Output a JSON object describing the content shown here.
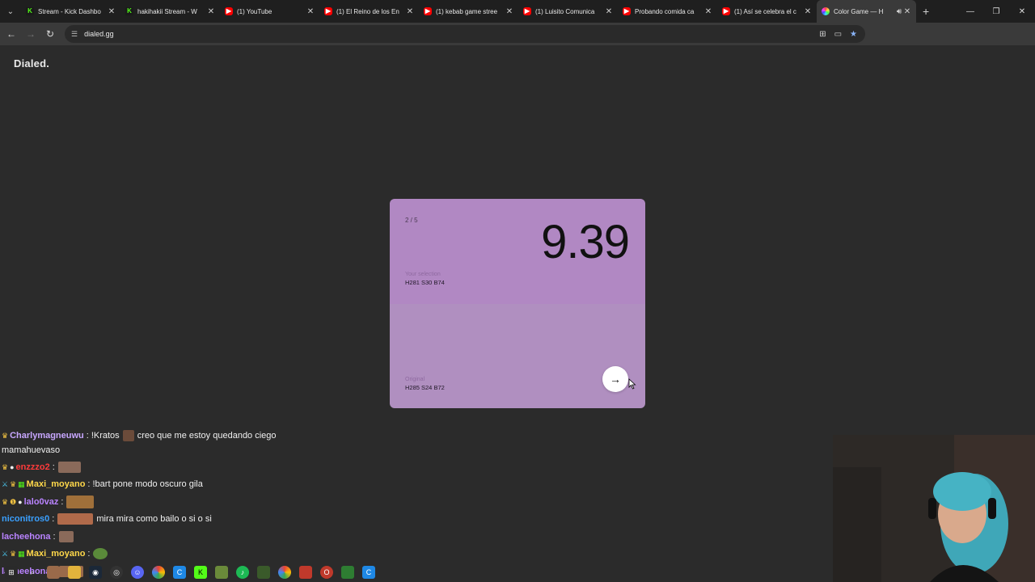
{
  "browser": {
    "tabs": [
      {
        "title": "Stream - Kick Dashbo",
        "favicon": "kick-icon"
      },
      {
        "title": "hakihakii Stream - W",
        "favicon": "kick-icon"
      },
      {
        "title": "(1) YouTube",
        "favicon": "youtube-icon"
      },
      {
        "title": "(1) El Reino de los En",
        "favicon": "youtube-icon"
      },
      {
        "title": "(1) kebab game stree",
        "favicon": "youtube-icon"
      },
      {
        "title": "(1) Luisito Comunica",
        "favicon": "youtube-icon"
      },
      {
        "title": "Probando comida ca",
        "favicon": "youtube-icon"
      },
      {
        "title": "(1) Así se celebra el c",
        "favicon": "youtube-icon"
      },
      {
        "title": "Color Game — H",
        "favicon": "color-game-icon"
      }
    ],
    "active_tab_index": 8,
    "url": "dialed.gg"
  },
  "page": {
    "brand": "Dialed.",
    "game": {
      "round": "2 / 5",
      "score": "9.39",
      "selection_label": "Your selection",
      "selection_value": "H281 S30 B74",
      "original_label": "Original",
      "original_value": "H285 S24 B72",
      "selection_color": "#b188c3",
      "original_color": "#b08fc0"
    }
  },
  "chat": [
    {
      "user": "Charlymagneuwu",
      "user_color": "#c8a7ff",
      "text": "!Kratos",
      "text2": "creo que me estoy quedando ciego"
    },
    {
      "user": "",
      "user_color": "#f0f0f0",
      "text": "mamahuevaso",
      "text2": ""
    },
    {
      "user": "enzzzo2",
      "user_color": "#ff3b3b",
      "text": "",
      "text2": ""
    },
    {
      "user": "Maxi_moyano",
      "user_color": "#ffd84a",
      "text": "!bart pone modo oscuro gila",
      "text2": ""
    },
    {
      "user": "lalo0vaz",
      "user_color": "#b983ff",
      "text": "",
      "text2": ""
    },
    {
      "user": "niconitros0",
      "user_color": "#3aa0ff",
      "text": "mira mira como bailo o si o si",
      "text2": ""
    },
    {
      "user": "lacheehona",
      "user_color": "#b983ff",
      "text": "",
      "text2": ""
    },
    {
      "user": "Maxi_moyano",
      "user_color": "#ffd84a",
      "text": "",
      "text2": ""
    },
    {
      "user": "lacheehona",
      "user_color": "#b983ff",
      "text": "",
      "text2": ""
    }
  ]
}
